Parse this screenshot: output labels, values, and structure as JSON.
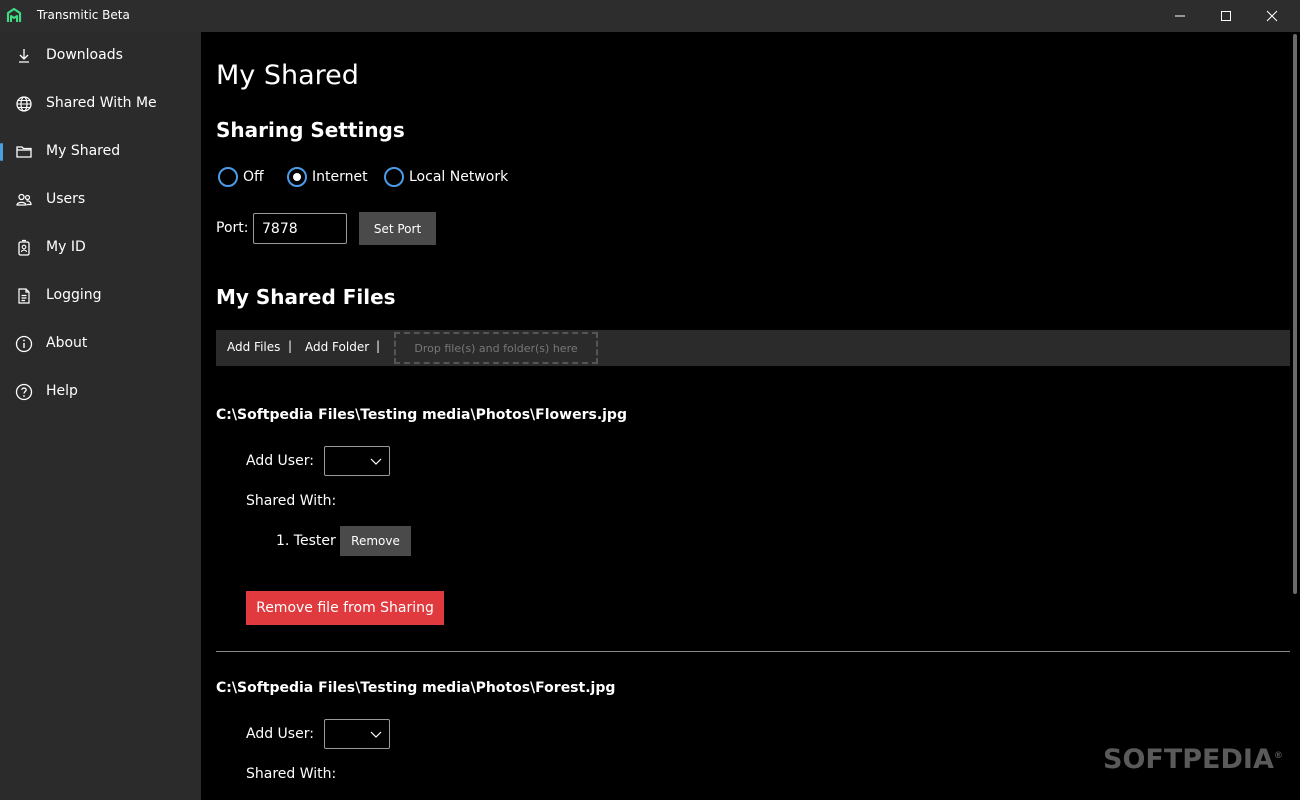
{
  "window": {
    "title": "Transmitic Beta",
    "controls": [
      "minimize-icon",
      "maximize-icon",
      "close-icon"
    ]
  },
  "colors": {
    "accent": "#4ca0e0",
    "radio": "#4c9be8",
    "danger": "#e0393e",
    "sidebar": "#2b2b2b",
    "content": "#000000"
  },
  "sidebar": {
    "items": [
      {
        "label": "Downloads",
        "icon": "download-icon"
      },
      {
        "label": "Shared With Me",
        "icon": "globe-icon"
      },
      {
        "label": "My Shared",
        "icon": "folder-icon",
        "active": true
      },
      {
        "label": "Users",
        "icon": "users-icon"
      },
      {
        "label": "My ID",
        "icon": "id-badge-icon"
      },
      {
        "label": "Logging",
        "icon": "document-icon"
      },
      {
        "label": "About",
        "icon": "info-icon"
      },
      {
        "label": "Help",
        "icon": "help-icon"
      }
    ]
  },
  "main": {
    "title": "My Shared",
    "sharing_settings": {
      "heading": "Sharing Settings",
      "options": [
        {
          "label": "Off",
          "selected": false
        },
        {
          "label": "Internet",
          "selected": true
        },
        {
          "label": "Local Network",
          "selected": false
        }
      ],
      "port_label": "Port:",
      "port_value": "7878",
      "set_port_label": "Set Port"
    },
    "shared_files": {
      "heading": "My Shared Files",
      "toolbar": {
        "add_files": "Add Files",
        "separator": "|",
        "add_folder": "Add Folder",
        "drop_hint": "Drop file(s) and folder(s) here"
      },
      "files": [
        {
          "path": "C:\\Softpedia Files\\Testing media\\Photos\\Flowers.jpg",
          "add_user_label": "Add User:",
          "shared_with_label": "Shared With:",
          "users": [
            {
              "label": "1. Tester",
              "remove_label": "Remove"
            }
          ],
          "remove_file_label": "Remove file from Sharing"
        },
        {
          "path": "C:\\Softpedia Files\\Testing media\\Photos\\Forest.jpg",
          "add_user_label": "Add User:",
          "shared_with_label": "Shared With:"
        }
      ]
    }
  },
  "watermark": {
    "text": "SOFTPEDIA",
    "mark": "®"
  }
}
